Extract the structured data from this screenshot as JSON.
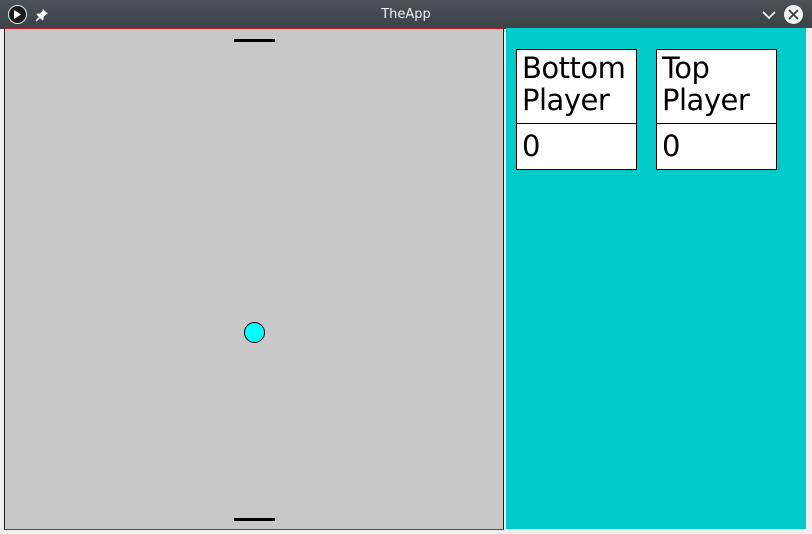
{
  "window": {
    "title": "TheApp",
    "icons": [
      "app-play-icon",
      "pin-icon",
      "minimize-chevron-icon",
      "close-icon"
    ]
  },
  "game": {
    "field_color": "#c8c8c8",
    "paddle_color": "#000000",
    "ball_color": "#00ffff"
  },
  "scoreboard": {
    "panel_color": "#00cbcb",
    "bottom_player": {
      "label": "Bottom Player",
      "score": "0"
    },
    "top_player": {
      "label": "Top Player",
      "score": "0"
    }
  }
}
